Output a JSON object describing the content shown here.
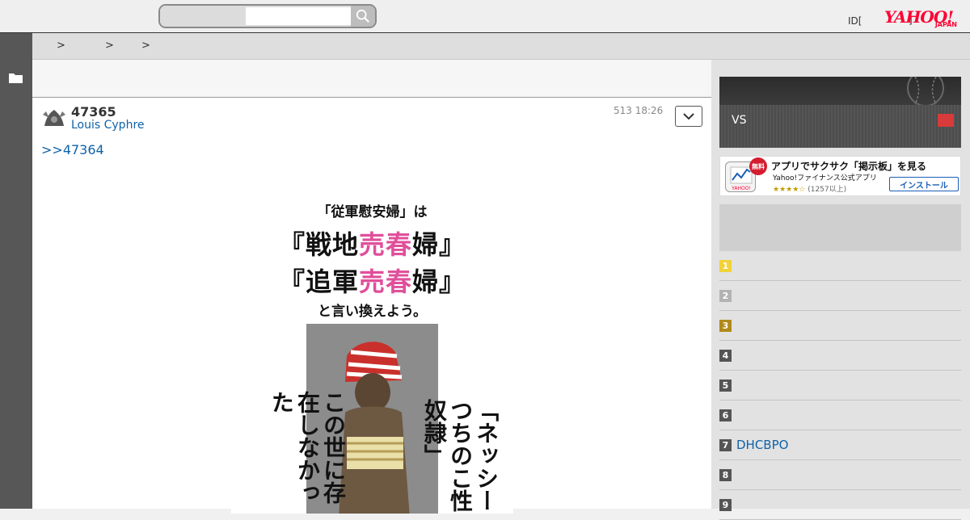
{
  "header": {
    "search_placeholder": "",
    "login_id": "ID[",
    "login_sep": "]",
    "logo": "YAHOO!",
    "logo_sub": "JAPAN"
  },
  "breadcrumb": [
    ">",
    ">",
    ">"
  ],
  "post": {
    "number": "47365",
    "user": "Louis Cyphre",
    "date": "513 18:26",
    "reply": ">>47364"
  },
  "poster": {
    "line1": "「従軍慰安婦」は",
    "line2_prefix": "『戦地",
    "line2_pink": "売春",
    "line2_suffix": "婦』",
    "line3_prefix": "『追軍",
    "line3_pink": "売春",
    "line3_suffix": "婦』",
    "line4": "と言い換えよう。",
    "vertical_left": "この世に存在しなかった",
    "vertical_right": "「ネッシーつちのこ性奴隷」"
  },
  "right": {
    "game_vs": "VS",
    "app": {
      "badge": "無料",
      "title": "アプリでサクサク「掲示板」を見る",
      "subtitle": "Yahoo!ファイナンス公式アプリ",
      "stars": "★★★★☆",
      "count": "(1257以上)",
      "install": "インストール"
    },
    "ranking": [
      {
        "num": "1",
        "label": "",
        "color": "#f1d23a"
      },
      {
        "num": "2",
        "label": "",
        "color": "#b3b3b3"
      },
      {
        "num": "3",
        "label": "",
        "color": "#b08a1a"
      },
      {
        "num": "4",
        "label": "",
        "color": "#555555"
      },
      {
        "num": "5",
        "label": "",
        "color": "#555555"
      },
      {
        "num": "6",
        "label": "",
        "color": "#555555"
      },
      {
        "num": "7",
        "label": "DHCBPO",
        "color": "#555555"
      },
      {
        "num": "8",
        "label": "",
        "color": "#555555"
      },
      {
        "num": "9",
        "label": "",
        "color": "#555555"
      }
    ]
  }
}
